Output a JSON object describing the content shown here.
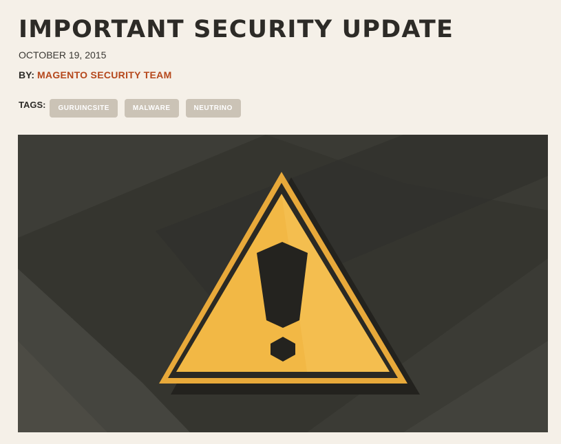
{
  "article": {
    "title": "IMPORTANT SECURITY UPDATE",
    "date": "OCTOBER 19, 2015",
    "by_label": "BY:",
    "author": "MAGENTO SECURITY TEAM",
    "tags_label": "TAGS:",
    "tags": [
      "GURUINCSITE",
      "MALWARE",
      "NEUTRINO"
    ]
  },
  "hero_image": {
    "icon": "warning-triangle-icon",
    "colors": {
      "background": "#35352f",
      "triangle_fill": "#f2b845",
      "triangle_border": "#2a2924",
      "author_link": "#b5471b",
      "tag_background": "#cbc3b6"
    }
  }
}
